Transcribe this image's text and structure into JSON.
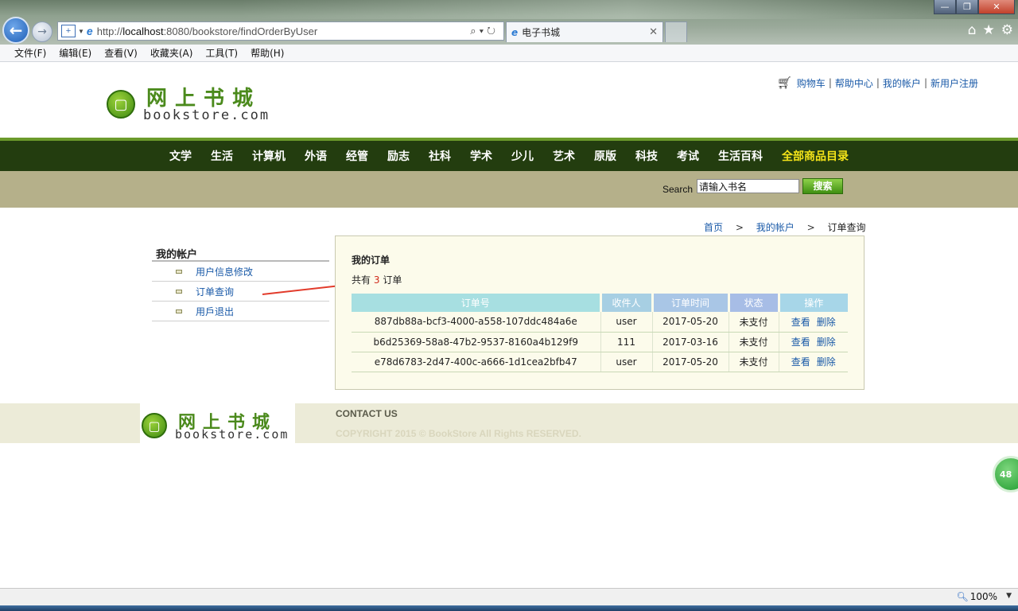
{
  "browser": {
    "url_prefix": "http://",
    "url_host": "localhost",
    "url_rest": ":8080/bookstore/findOrderByUser",
    "tab_title": "电子书城",
    "menu": [
      "文件(F)",
      "编辑(E)",
      "查看(V)",
      "收藏夹(A)",
      "工具(T)",
      "帮助(H)"
    ],
    "zoom": "100%"
  },
  "header": {
    "logo_cn": "网上书城",
    "logo_en": "bookstore.com",
    "links": [
      "购物车",
      "帮助中心",
      "我的帐户",
      "新用户注册"
    ],
    "link_separator": "|"
  },
  "nav": {
    "items": [
      "文学",
      "生活",
      "计算机",
      "外语",
      "经管",
      "励志",
      "社科",
      "学术",
      "少儿",
      "艺术",
      "原版",
      "科技",
      "考试",
      "生活百科",
      "全部商品目录"
    ],
    "highlight_color": "#f5e419"
  },
  "search": {
    "label": "Search",
    "value": "请输入书名",
    "button": "搜索"
  },
  "breadcrumb": {
    "home": "首页",
    "account": "我的帐户",
    "current": "订单查询",
    "separator": ">"
  },
  "sidebar": {
    "title": "我的帐户",
    "items": [
      "用户信息修改",
      "订单查询",
      "用戶退出"
    ]
  },
  "orders": {
    "title": "我的订单",
    "count_prefix": "共有",
    "count": "3",
    "count_suffix": "订单",
    "columns": [
      "订单号",
      "收件人",
      "订单时间",
      "状态",
      "操作"
    ],
    "rows": [
      {
        "id": "887db88a-bcf3-4000-a558-107ddc484a6e",
        "receiver": "user",
        "time": "2017-05-20",
        "status": "未支付",
        "view": "查看",
        "delete": "删除"
      },
      {
        "id": "b6d25369-58a8-47b2-9537-8160a4b129f9",
        "receiver": "111",
        "time": "2017-03-16",
        "status": "未支付",
        "view": "查看",
        "delete": "删除"
      },
      {
        "id": "e78d6783-2d47-400c-a666-1d1cea2bfb47",
        "receiver": "user",
        "time": "2017-05-20",
        "status": "未支付",
        "view": "查看",
        "delete": "删除"
      }
    ]
  },
  "footer": {
    "logo_cn": "网上书城",
    "logo_en": "bookstore.com",
    "contact": "CONTACT US",
    "copyright": "COPYRIGHT 2015 © BookStore All Rights RESERVED."
  },
  "floating_badge": "48",
  "colors": {
    "nav_bg": "#233d0f",
    "search_bg": "#b5b08a",
    "link": "#1a5aa8",
    "count_red": "#d02a1a",
    "arrow_red": "#e23b2b"
  }
}
